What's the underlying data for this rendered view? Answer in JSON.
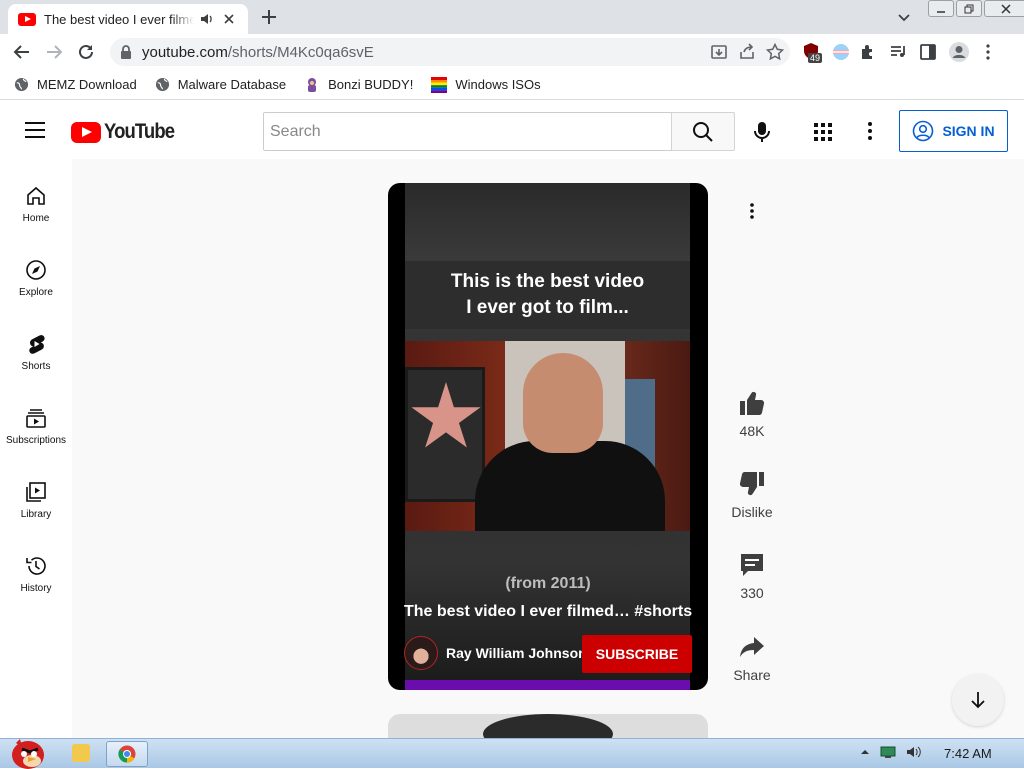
{
  "browser": {
    "tab_title": "The best video I ever filmed… #shorts - YouTube",
    "url_host": "youtube.com",
    "url_path": "/shorts/M4Kc0qa6svE",
    "extension_badge": "49",
    "bookmarks": [
      "MEMZ Download",
      "Malware Database",
      "Bonzi BUDDY!",
      "Windows ISOs"
    ]
  },
  "youtube": {
    "logo_text": "YouTube",
    "search_placeholder": "Search",
    "sign_in": "SIGN IN",
    "sidebar": [
      {
        "label": "Home",
        "icon": "home-icon"
      },
      {
        "label": "Explore",
        "icon": "compass-icon"
      },
      {
        "label": "Shorts",
        "icon": "shorts-icon"
      },
      {
        "label": "Subscriptions",
        "icon": "subscriptions-icon"
      },
      {
        "label": "Library",
        "icon": "library-icon"
      },
      {
        "label": "History",
        "icon": "history-icon"
      }
    ],
    "short": {
      "caption_top_line1": "This is the best video",
      "caption_top_line2": "I ever got to film...",
      "caption_bottom": "(from 2011)",
      "title": "The best video I ever filmed… #shorts",
      "channel": "Ray William Johnson",
      "subscribe": "SUBSCRIBE",
      "likes": "48K",
      "dislike": "Dislike",
      "comments": "330",
      "share": "Share"
    }
  },
  "taskbar": {
    "time": "7:42 AM"
  },
  "colors": {
    "yt_red": "#ff0000",
    "subscribe_red": "#cc0000",
    "link_blue": "#065fd4",
    "progress_purple": "#6a0dad"
  }
}
